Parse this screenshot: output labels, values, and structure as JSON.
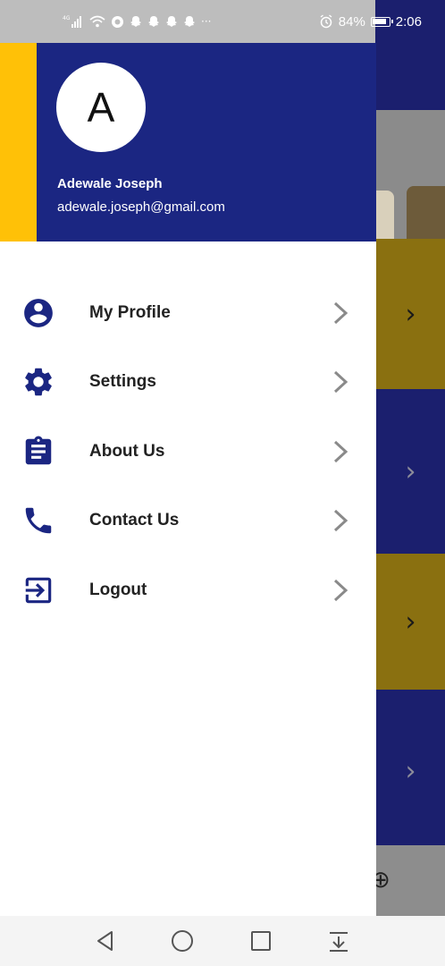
{
  "status_bar": {
    "left_icons": [
      "4G-signal-icon",
      "wifi-icon",
      "data-saver-icon",
      "snapchat-icon",
      "snapchat-icon",
      "snapchat-icon",
      "snapchat-icon"
    ],
    "more": "···",
    "battery_percent": "84%",
    "time": "2:06"
  },
  "drawer": {
    "avatar_letter": "A",
    "user_name": "Adewale Joseph",
    "user_email": "adewale.joseph@gmail.com",
    "menu": [
      {
        "label": "My Profile",
        "icon": "account-circle-icon"
      },
      {
        "label": "Settings",
        "icon": "gear-icon"
      },
      {
        "label": "About Us",
        "icon": "clipboard-icon"
      },
      {
        "label": "Contact Us",
        "icon": "phone-icon"
      },
      {
        "label": "Logout",
        "icon": "logout-icon"
      }
    ]
  },
  "colors": {
    "primary": "#1b2682",
    "accent": "#ffc107",
    "icon": "#1b2682",
    "chevron": "#8a8a8a"
  },
  "nav_bar": {
    "buttons": [
      "back-icon",
      "home-icon",
      "recents-icon",
      "notification-pull-icon"
    ]
  }
}
